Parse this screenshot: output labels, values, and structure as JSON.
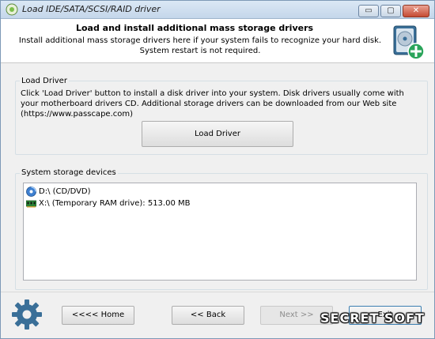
{
  "window": {
    "title": "Load IDE/SATA/SCSI/RAID driver",
    "controls": {
      "minimize": "▭",
      "maximize": "▢",
      "close": "✕"
    }
  },
  "header": {
    "title": "Load and install additional mass storage drivers",
    "subtitle": "Install additional mass storage drivers here if your system fails to recognize your hard disk. System restart is not required.",
    "icon": "disk-add-icon"
  },
  "load_driver": {
    "group_label": "Load Driver",
    "description": "Click 'Load Driver' button to install a disk driver into your system. Disk drivers usually come with your motherboard drivers CD. Additional storage drivers can be downloaded from our Web site (https://www.passcape.com)",
    "button_label": "Load Driver"
  },
  "storage": {
    "group_label": "System storage devices",
    "devices": [
      {
        "label": "D:\\  (CD/DVD)",
        "icon": "cd-dvd-icon"
      },
      {
        "label": "X:\\  (Temporary RAM drive):  513.00 MB",
        "icon": "ram-drive-icon"
      }
    ]
  },
  "footer": {
    "home_label": "<<<< Home",
    "back_label": "<< Back",
    "next_label": "Next >>",
    "exit_label": "Exit",
    "watermark": "SECRET SOFT"
  },
  "colors": {
    "accent": "#3c7fb1",
    "close_button": "#c54a33",
    "disk_plus": "#2aa45a"
  }
}
